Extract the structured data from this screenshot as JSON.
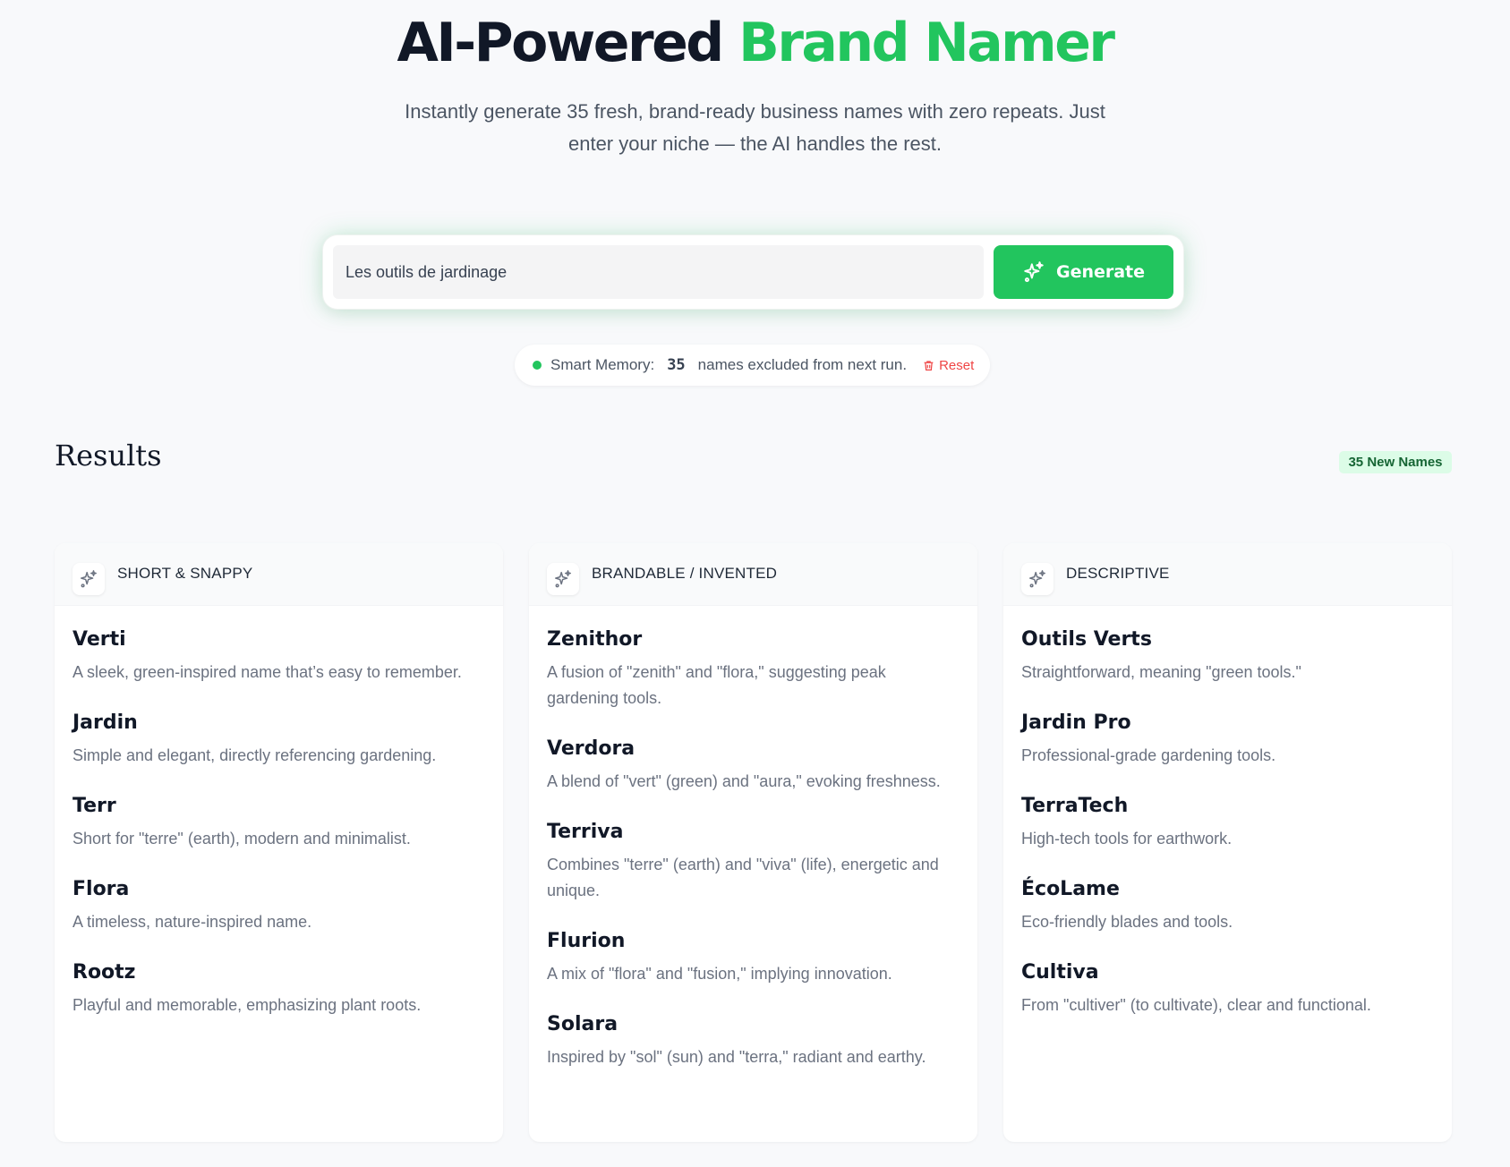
{
  "hero": {
    "title_main": "AI-Powered",
    "title_accent": "Brand Namer",
    "subtitle": "Instantly generate 35 fresh, brand-ready business names with zero repeats. Just enter your niche — the AI handles the rest."
  },
  "search": {
    "value": "Les outils de jardinage",
    "button_label": "Generate"
  },
  "memory": {
    "label": "Smart Memory:",
    "count": "35",
    "suffix": "names excluded from next run.",
    "reset_label": "Reset"
  },
  "results": {
    "title": "Results",
    "badge": "35 New Names",
    "columns": [
      {
        "title": "SHORT & SNAPPY",
        "items": [
          {
            "name": "Verti",
            "desc": "A sleek, green-inspired name that’s easy to remember."
          },
          {
            "name": "Jardin",
            "desc": "Simple and elegant, directly referencing gardening."
          },
          {
            "name": "Terr",
            "desc": "Short for \"terre\" (earth), modern and minimalist."
          },
          {
            "name": "Flora",
            "desc": "A timeless, nature-inspired name."
          },
          {
            "name": "Rootz",
            "desc": "Playful and memorable, emphasizing plant roots."
          }
        ]
      },
      {
        "title": "BRANDABLE / INVENTED",
        "items": [
          {
            "name": "Zenithor",
            "desc": "A fusion of \"zenith\" and \"flora,\" suggesting peak gardening tools."
          },
          {
            "name": "Verdora",
            "desc": "A blend of \"vert\" (green) and \"aura,\" evoking freshness."
          },
          {
            "name": "Terriva",
            "desc": "Combines \"terre\" (earth) and \"viva\" (life), energetic and unique."
          },
          {
            "name": "Flurion",
            "desc": "A mix of \"flora\" and \"fusion,\" implying innovation."
          },
          {
            "name": "Solara",
            "desc": "Inspired by \"sol\" (sun) and \"terra,\" radiant and earthy."
          }
        ]
      },
      {
        "title": "DESCRIPTIVE",
        "items": [
          {
            "name": "Outils Verts",
            "desc": "Straightforward, meaning \"green tools.\""
          },
          {
            "name": "Jardin Pro",
            "desc": "Professional-grade gardening tools."
          },
          {
            "name": "TerraTech",
            "desc": "High-tech tools for earthwork."
          },
          {
            "name": "ÉcoLame",
            "desc": "Eco-friendly blades and tools."
          },
          {
            "name": "Cultiva",
            "desc": "From \"cultiver\" (to cultivate), clear and functional."
          }
        ]
      }
    ]
  },
  "colors": {
    "accent": "#22c55e",
    "heading": "#111827",
    "muted": "#6b7280",
    "danger": "#ef4444",
    "background": "#f8f9fb"
  },
  "icons": {
    "generate": "sparkles-icon",
    "reset": "trash-icon",
    "column": "sparkles-icon"
  }
}
